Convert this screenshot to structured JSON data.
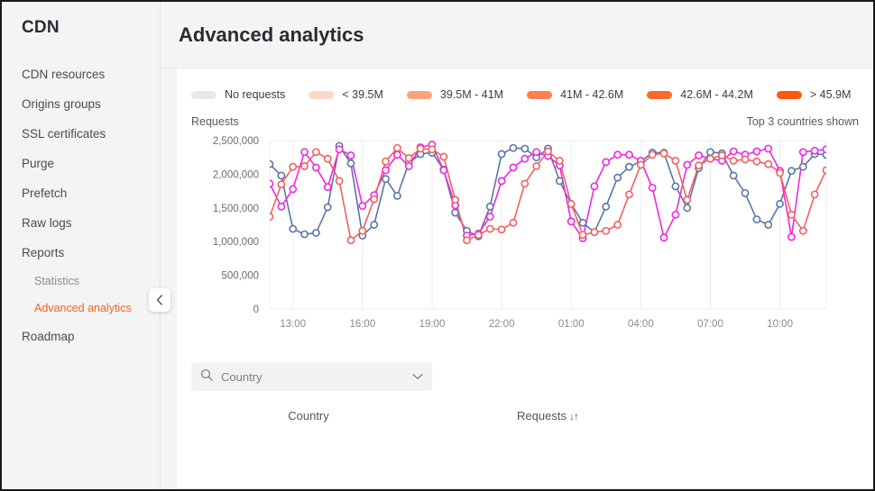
{
  "sidebar": {
    "brand": "CDN",
    "collapse_icon": "chevron-left-icon",
    "items": [
      {
        "label": "CDN resources",
        "type": "item",
        "active": false
      },
      {
        "label": "Origins groups",
        "type": "item",
        "active": false
      },
      {
        "label": "SSL certificates",
        "type": "item",
        "active": false
      },
      {
        "label": "Purge",
        "type": "item",
        "active": false
      },
      {
        "label": "Prefetch",
        "type": "item",
        "active": false
      },
      {
        "label": "Raw logs",
        "type": "item",
        "active": false
      },
      {
        "label": "Reports",
        "type": "item",
        "active": false
      },
      {
        "label": "Statistics",
        "type": "sub",
        "active": false
      },
      {
        "label": "Advanced analytics",
        "type": "sub",
        "active": true
      },
      {
        "label": "Roadmap",
        "type": "item",
        "active": false
      }
    ],
    "active_color": "#f26322"
  },
  "header": {
    "title": "Advanced analytics"
  },
  "legend": {
    "items": [
      {
        "label": "No requests",
        "color": "#e8e8ea"
      },
      {
        "label": "< 39.5M",
        "color": "#fcd8c6"
      },
      {
        "label": "39.5M - 41M",
        "color": "#fba47c"
      },
      {
        "label": "41M - 42.6M",
        "color": "#fa8150"
      },
      {
        "label": "42.6M - 44.2M",
        "color": "#fb6a2a"
      },
      {
        "label": "> 45.9M",
        "color": "#fa5a0a"
      }
    ]
  },
  "subhead": {
    "left_label": "Requests",
    "right_label": "Top 3 countries shown"
  },
  "search": {
    "placeholder": "Country",
    "search_icon": "search-icon",
    "chevron_icon": "chevron-down-icon"
  },
  "table": {
    "columns": [
      {
        "label": "Country",
        "sortable": false
      },
      {
        "label": "Requests",
        "sortable": true,
        "sort_glyph": "↓↑"
      }
    ],
    "rows": []
  },
  "chart_data": {
    "type": "line",
    "title": "",
    "xlabel": "",
    "ylabel": "Requests",
    "ylim": [
      0,
      2500000
    ],
    "ytick_labels": [
      "0",
      "500,000",
      "1,000,000",
      "1,500,000",
      "2,000,000",
      "2,500,000"
    ],
    "yticks": [
      0,
      500000,
      1000000,
      1500000,
      2000000,
      2500000
    ],
    "xtick_labels": [
      "13:00",
      "16:00",
      "19:00",
      "22:00",
      "01:00",
      "04:00",
      "07:00",
      "10:00"
    ],
    "xtick_indices": [
      2,
      8,
      14,
      20,
      26,
      32,
      38,
      44
    ],
    "grid": {
      "vertical": true,
      "horizontal": false
    },
    "legend_position": "none",
    "x_count": 49,
    "series": [
      {
        "name": "series-1",
        "color": "#5a76a8",
        "values": [
          2150000,
          1980000,
          1190000,
          1110000,
          1130000,
          1510000,
          2420000,
          2160000,
          1090000,
          1250000,
          1930000,
          1680000,
          2170000,
          2300000,
          2320000,
          2070000,
          1430000,
          1160000,
          1080000,
          1520000,
          2300000,
          2390000,
          2380000,
          2250000,
          2380000,
          1900000,
          1560000,
          1280000,
          1140000,
          1520000,
          1950000,
          2110000,
          2190000,
          2320000,
          2320000,
          1820000,
          1500000,
          2090000,
          2330000,
          2310000,
          1980000,
          1720000,
          1330000,
          1250000,
          1560000,
          2050000,
          2110000,
          2300000,
          2290000
        ]
      },
      {
        "name": "series-2",
        "color": "#f128e0",
        "values": [
          1860000,
          1520000,
          1780000,
          2330000,
          2100000,
          1810000,
          2370000,
          2280000,
          1530000,
          1690000,
          2060000,
          2290000,
          2120000,
          2400000,
          2440000,
          2060000,
          1540000,
          1090000,
          1120000,
          1370000,
          1900000,
          2100000,
          2230000,
          2330000,
          2270000,
          2130000,
          1300000,
          1050000,
          1820000,
          2180000,
          2290000,
          2290000,
          2200000,
          1800000,
          1060000,
          1400000,
          2140000,
          2280000,
          2230000,
          2200000,
          2340000,
          2290000,
          2340000,
          2380000,
          2050000,
          1070000,
          2330000,
          2350000,
          2370000
        ]
      },
      {
        "name": "series-3",
        "color": "#f4605f",
        "values": [
          1370000,
          1850000,
          2110000,
          2120000,
          2330000,
          2230000,
          1900000,
          1020000,
          1160000,
          1630000,
          2190000,
          2390000,
          2240000,
          2380000,
          2370000,
          2260000,
          1620000,
          1020000,
          1100000,
          1190000,
          1180000,
          1280000,
          1860000,
          2120000,
          2340000,
          2200000,
          1560000,
          1100000,
          1140000,
          1160000,
          1250000,
          1700000,
          2140000,
          2290000,
          2310000,
          2200000,
          1620000,
          2130000,
          2230000,
          2280000,
          2200000,
          2220000,
          2190000,
          2150000,
          2020000,
          1400000,
          1160000,
          1700000,
          2060000
        ]
      }
    ]
  }
}
